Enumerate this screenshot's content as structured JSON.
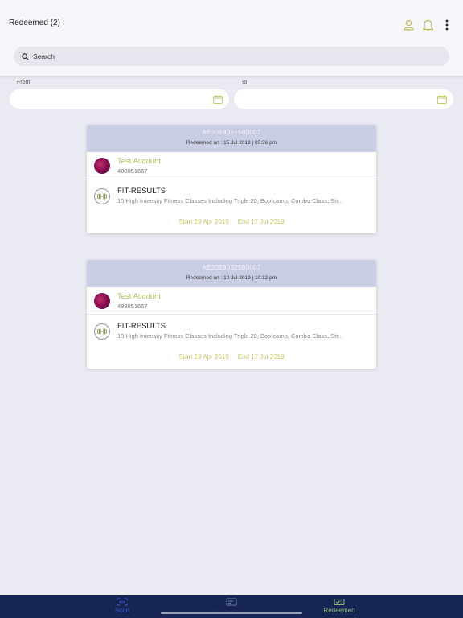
{
  "header": {
    "title": "Redeemed (2)"
  },
  "search": {
    "placeholder": "Search"
  },
  "filters": {
    "from_label": "From",
    "to_label": "To"
  },
  "cards": [
    {
      "id": "AE2019061500007",
      "redeemed_on": "Redeemed on : 15 Jul 2019 | 05:36 pm",
      "user_name": "Test Account",
      "user_phone": "488851667",
      "plan_name": "FIT-RESULTS",
      "plan_desc": "10 High Intensity Fitness Classes Including Triple 20, Bootcamp, Combo Class, Str...",
      "start": "Start 19 Apr 2019",
      "end": "End 17 Jul 2019"
    },
    {
      "id": "AE2019052500007",
      "redeemed_on": "Redeemed on : 10 Jul 2019 | 10:12 pm",
      "user_name": "Test Account",
      "user_phone": "488851667",
      "plan_name": "FIT-RESULTS",
      "plan_desc": "10 High Intensity Fitness Classes Including Triple 20, Bootcamp, Combo Class, Str...",
      "start": "Start 19 Apr 2019",
      "end": "End 17 Jul 2019"
    }
  ],
  "tabs": [
    {
      "label": "Scan",
      "color": "#3b5bd9"
    },
    {
      "label": "Membership",
      "color": "#222a5a"
    },
    {
      "label": "Redeemed",
      "color": "#8bbf7a"
    }
  ],
  "colors": {
    "accent": "#b8b85a",
    "nav_bg": "#172554",
    "card_header": "#c8cde3"
  },
  "icons": [
    "user-icon",
    "bell-icon",
    "more-vertical-icon",
    "search-icon",
    "calendar-icon",
    "dumbbell-icon",
    "scan-icon",
    "membership-card-icon",
    "redeemed-ticket-icon"
  ]
}
